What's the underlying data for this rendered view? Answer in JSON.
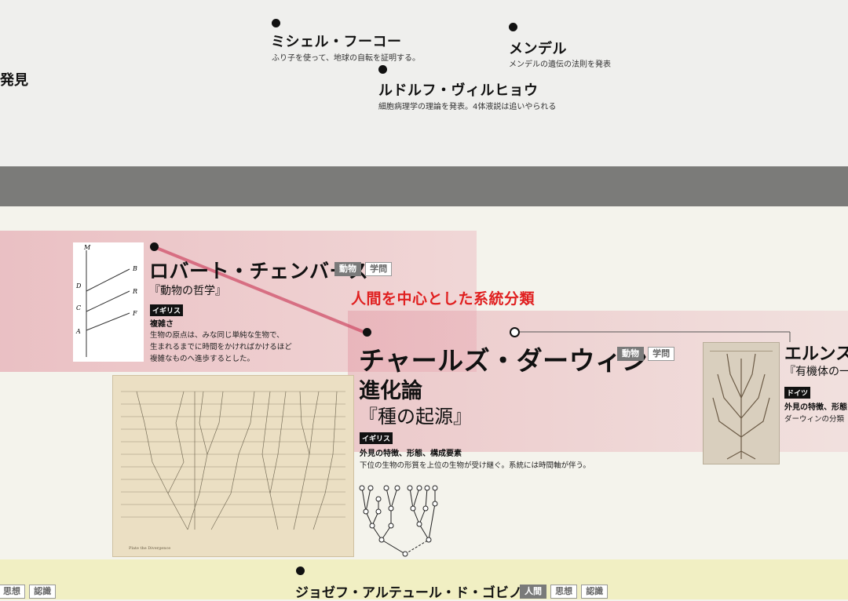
{
  "top": {
    "left_fragment": "発見",
    "foucault": {
      "name": "ミシェル・フーコー",
      "desc": "ふり子を使って、地球の自転を証明する。"
    },
    "mendel": {
      "name": "メンデル",
      "desc": "メンデルの遺伝の法則を発表"
    },
    "virchow": {
      "name": "ルドルフ・ヴィルヒョウ",
      "desc": "細胞病理学の理論を発表。4体液説は追いやられる"
    }
  },
  "chambers": {
    "name": "ロバート・チェンバース",
    "work": "『動物の哲学』",
    "tags": [
      "動物",
      "学問"
    ],
    "country": "イギリス",
    "keyword": "複雑さ",
    "desc": [
      "生物の原点は、みな同じ単純な生物で、",
      "生まれるまでに時間をかければかけるほど",
      "複雑なものへ進歩するとした。"
    ],
    "figure_labels": [
      "M",
      "B",
      "D",
      "R",
      "C",
      "F",
      "A"
    ]
  },
  "annotation": {
    "label": "人間を中心とした系統分類",
    "color": "#e02020"
  },
  "darwin": {
    "name": "チャールズ・ダーウィン",
    "theory": "進化論",
    "work": "『種の起源』",
    "tags": [
      "動物",
      "学問"
    ],
    "country": "イギリス",
    "keyword": "外見の特徴、形態、構成要素",
    "desc": "下位の生物の形質を上位の生物が受け継ぐ。系統には時間軸が伴う。",
    "plate_caption": "Plate the Divergence"
  },
  "haeckel": {
    "name": "エルンス",
    "work": "『有機体の一",
    "country": "ドイツ",
    "keyword": "外見の特徴、形態",
    "desc": "ダーウィンの分類"
  },
  "bottom": {
    "left_tags": [
      "思想",
      "認識"
    ],
    "gobineau": {
      "name": "ジョゼフ・アルテュール・ド・ゴビノー",
      "tags": [
        "人間",
        "思想",
        "認識"
      ]
    }
  }
}
